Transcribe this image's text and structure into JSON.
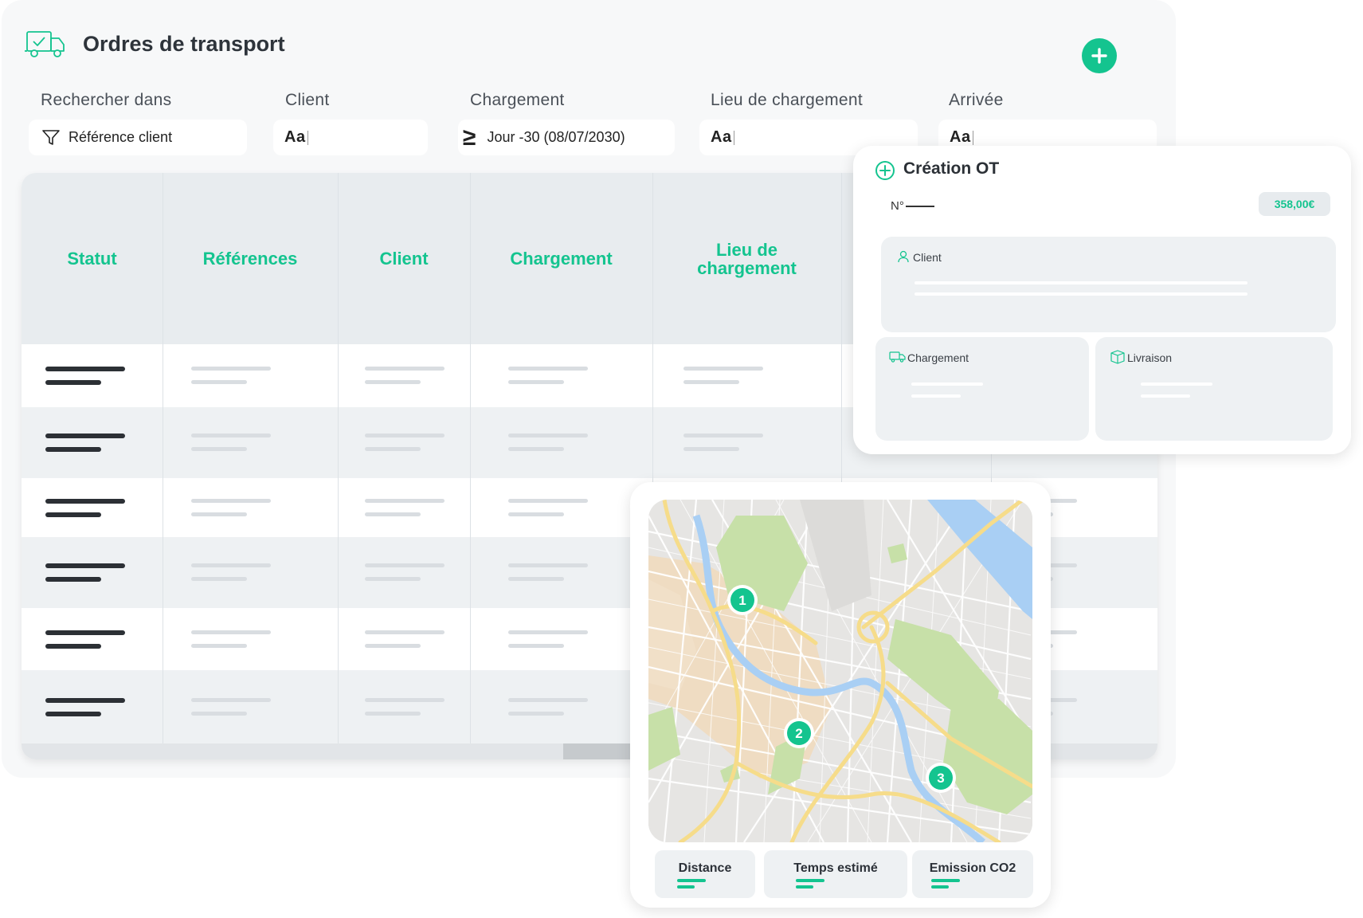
{
  "header": {
    "title": "Ordres de transport"
  },
  "filters": {
    "search_in": {
      "label": "Rechercher dans",
      "value": "Référence client"
    },
    "client": {
      "label": "Client",
      "placeholder": "Aa"
    },
    "loading": {
      "label": "Chargement",
      "operator": "≥",
      "value": "Jour -30 (08/07/2030)"
    },
    "loading_place": {
      "label": "Lieu de chargement",
      "placeholder": "Aa"
    },
    "arrival": {
      "label": "Arrivée",
      "placeholder": "Aa"
    }
  },
  "table": {
    "columns": [
      "Statut",
      "Références",
      "Client",
      "Chargement",
      "Lieu de\nchargement"
    ]
  },
  "creation_card": {
    "title": "Création OT",
    "number_label": "N°",
    "price": "358,00€",
    "sections": {
      "client": "Client",
      "loading": "Chargement",
      "delivery": "Livraison"
    }
  },
  "map_card": {
    "markers": [
      "1",
      "2",
      "3"
    ],
    "stats": [
      "Distance",
      "Temps estimé",
      "Emission CO2"
    ]
  },
  "colors": {
    "accent": "#14c48f",
    "dark_text": "#2c3138"
  }
}
